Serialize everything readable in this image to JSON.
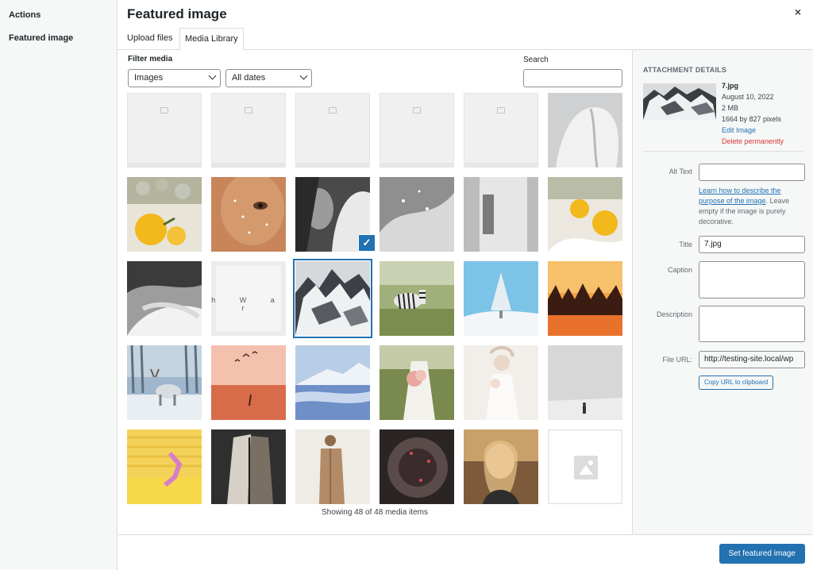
{
  "menu": {
    "actions": "Actions",
    "featured_image": "Featured image"
  },
  "frame": {
    "title": "Featured image",
    "close": "×"
  },
  "tabs": {
    "upload": "Upload files",
    "library": "Media Library"
  },
  "toolbar": {
    "filter_label": "Filter media",
    "media_type": "Images",
    "dates": "All dates",
    "search_label": "Search",
    "search_value": ""
  },
  "grid": {
    "tiles": [
      "placeholder",
      "placeholder",
      "placeholder",
      "placeholder",
      "placeholder",
      "white-shirt",
      "lemons",
      "freckles-face",
      "woman-sleeve",
      "white-fabric",
      "white-tshirt",
      "lemons-2",
      "woman-hair",
      "letters-print",
      "snowy-mountain",
      "zebra",
      "snow-tree",
      "sunset-lake",
      "reindeer",
      "birds-sunset",
      "blue-glacier",
      "bride-bouquet",
      "bride-flowers",
      "figure-gray",
      "yellow-slide",
      "layered-coats",
      "beige-coat",
      "round-mirror",
      "smiling-woman",
      "blank"
    ],
    "letters": "h W a r",
    "selected_index": 14,
    "count_text": "Showing 48 of 48 media items"
  },
  "details": {
    "heading": "Attachment Details",
    "filename": "7.jpg",
    "date": "August 10, 2022",
    "size": "2 MB",
    "dimensions": "1664 by 827 pixels",
    "edit_link": "Edit Image",
    "delete_link": "Delete permanently",
    "alt_label": "Alt Text",
    "alt_value": "",
    "help_link": "Learn how to describe the purpose of the image",
    "help_text": ". Leave empty if the image is purely decorative.",
    "title_label": "Title",
    "title_value": "7.jpg",
    "caption_label": "Caption",
    "caption_value": "",
    "description_label": "Description",
    "description_value": "",
    "url_label": "File URL:",
    "url_value": "http://testing-site.local/wp",
    "copy_button": "Copy URL to clipboard"
  },
  "footer": {
    "primary_button": "Set featured image"
  },
  "colors": {
    "accent": "#2271b1",
    "danger": "#d63638",
    "sidebar_bg": "#f6f7f7"
  }
}
